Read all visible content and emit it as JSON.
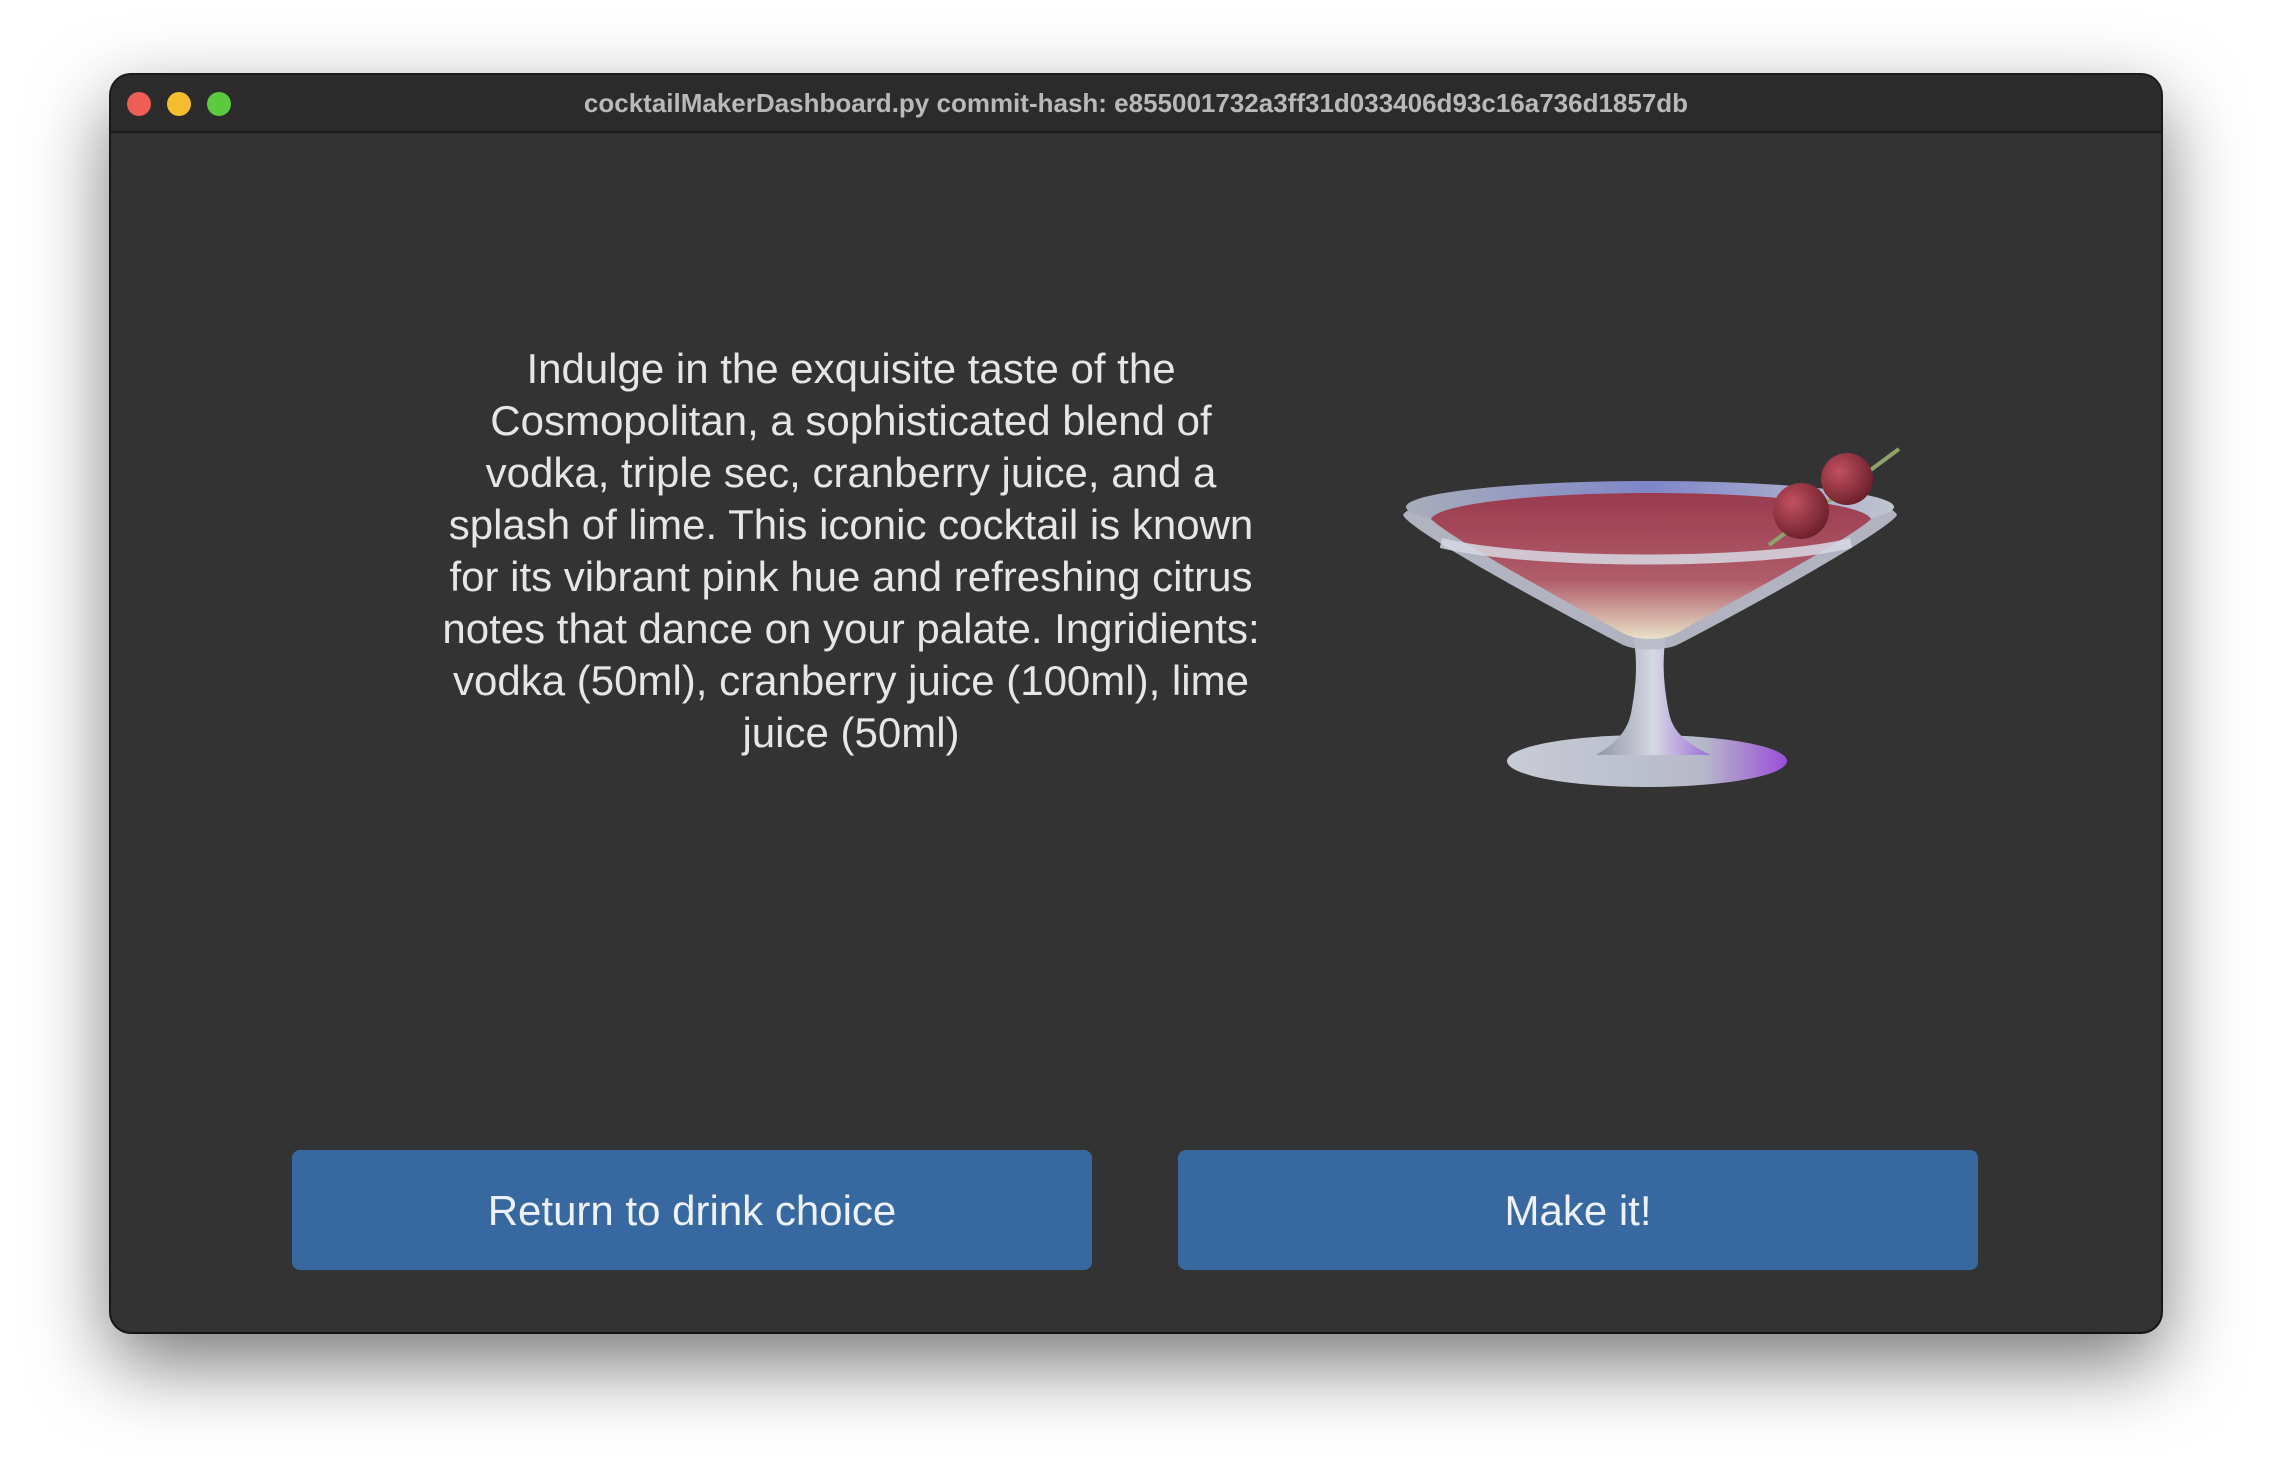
{
  "window": {
    "title": "cocktailMakerDashboard.py commit-hash: e855001732a3ff31d033406d93c16a736d1857db",
    "traffic_lights": {
      "close_color": "#ee5e56",
      "minimize_color": "#f4bd2e",
      "maximize_color": "#5dc93f"
    }
  },
  "drink": {
    "description": "Indulge in the exquisite taste of the Cosmopolitan, a sophisticated blend of vodka, triple sec, cranberry juice, and a splash of lime. This iconic cocktail is known for its vibrant pink hue and refreshing citrus notes that dance on your palate. Ingridients: vodka (50ml), cranberry juice (100ml), lime juice (50ml)",
    "image_icon": "cocktail-glass-icon"
  },
  "buttons": {
    "return_label": "Return to drink choice",
    "make_label": "Make it!",
    "accent_color": "#3769a0"
  }
}
